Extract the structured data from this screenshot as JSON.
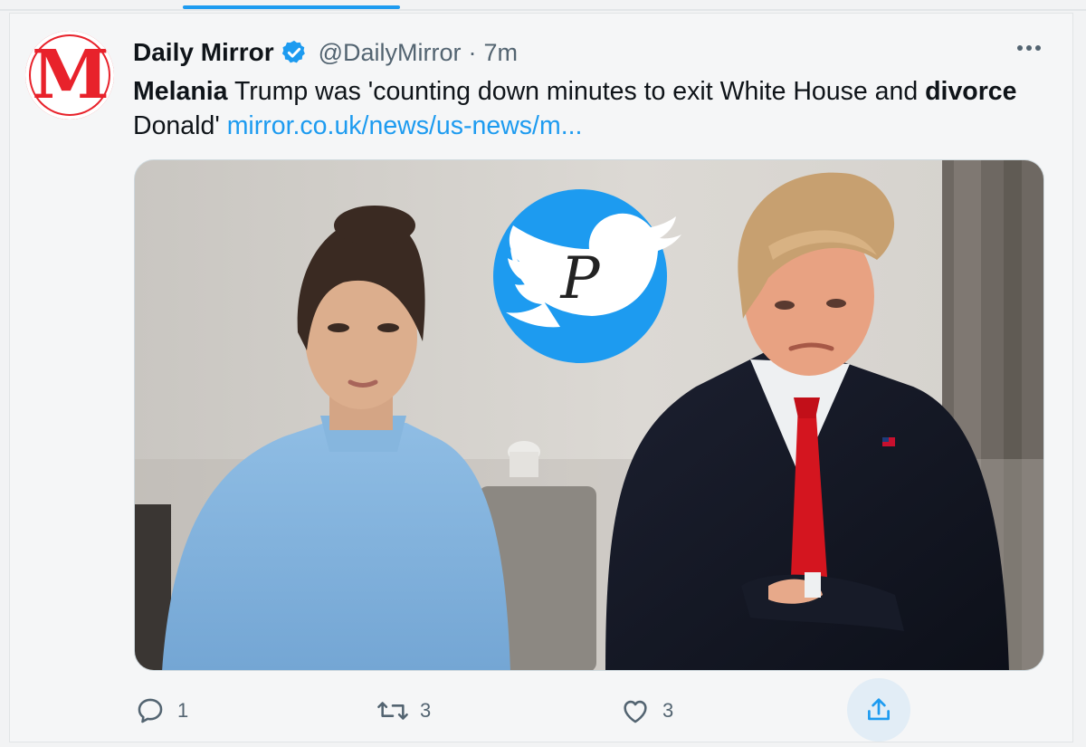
{
  "tweet": {
    "author": {
      "display_name": "Daily Mirror",
      "handle": "@DailyMirror",
      "verified": true,
      "avatar_letter": "M",
      "avatar_color": "#e8222b"
    },
    "separator": "·",
    "time": "7m",
    "text": {
      "part1_bold": "Melania",
      "part2": " Trump was 'counting down minutes to exit White House and ",
      "part3_bold": "divorce",
      "part4": " Donald' ",
      "link": "mirror.co.uk/news/us-news/m..."
    },
    "media": {
      "watermark_icon": "twitter-bird-icon",
      "watermark_letter": "P"
    },
    "actions": {
      "reply_count": "1",
      "retweet_count": "3",
      "like_count": "3"
    }
  },
  "colors": {
    "accent": "#1d9bf0",
    "secondary_text": "#536471",
    "brand_red": "#e8222b"
  }
}
